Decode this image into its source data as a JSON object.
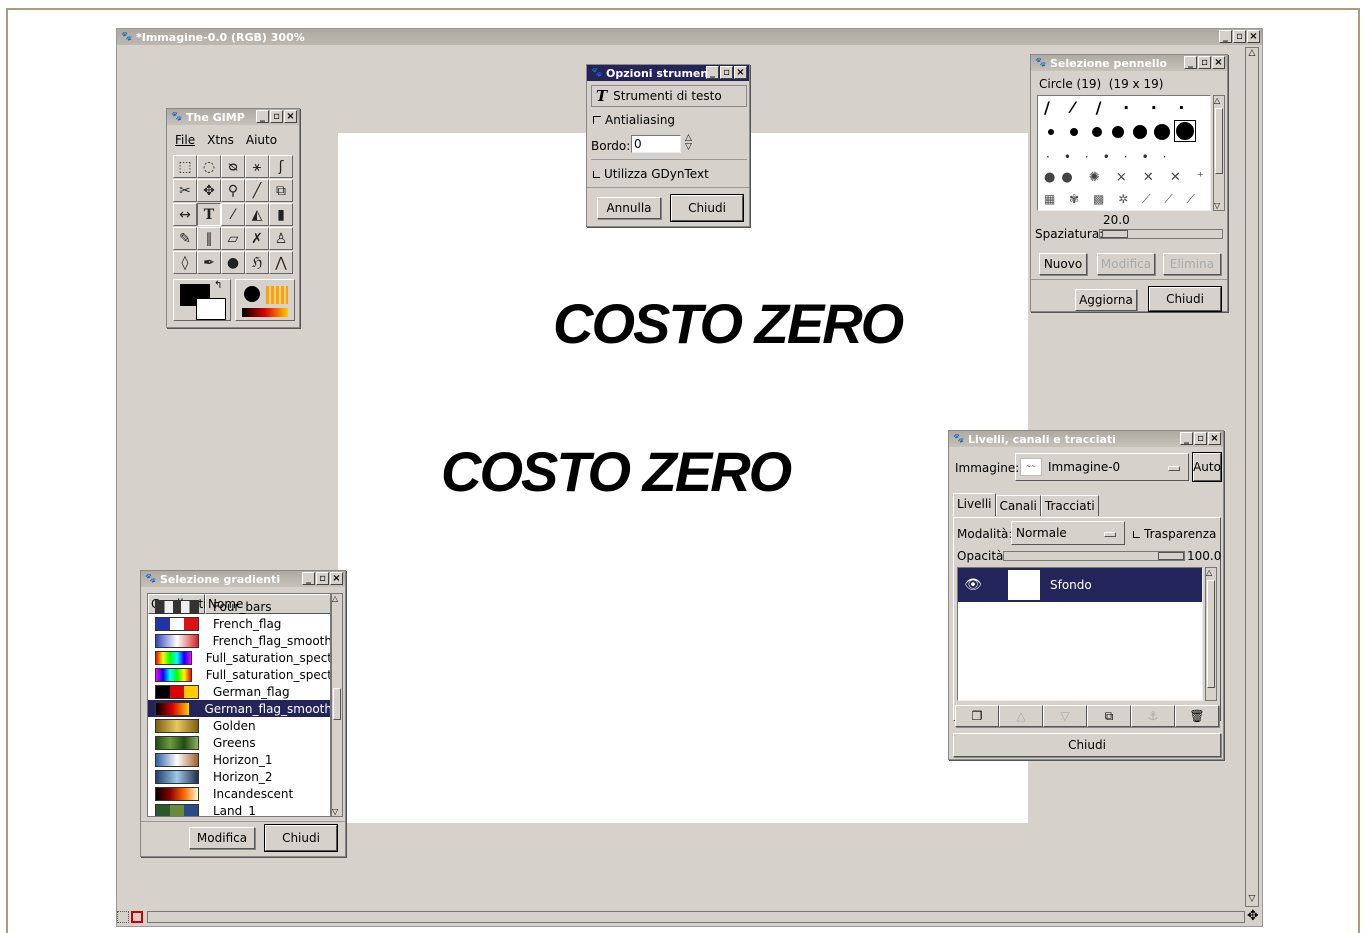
{
  "main_window": {
    "title": "*Immagine-0.0 (RGB) 300%",
    "canvas_text_1": "COSTO ZERO",
    "canvas_text_2": "COSTO ZERO"
  },
  "toolbox": {
    "title": "The GIMP",
    "menu": [
      "File",
      "Xtns",
      "Aiuto"
    ]
  },
  "tool_options": {
    "title": "Opzioni strumenti",
    "tool_label": "Strumenti di testo",
    "antialiasing_label": "Antialiasing",
    "border_label": "Bordo:",
    "border_value": "0",
    "gdyntext_label": "Utilizza GDynText",
    "cancel_label": "Annulla",
    "close_label": "Chiudi"
  },
  "brush_selector": {
    "title": "Selezione pennello",
    "brush_name": "Circle (19)  (19 x 19)",
    "spacing_value": "20.0",
    "spacing_label": "Spaziatura:",
    "new_label": "Nuovo",
    "edit_label": "Modifica",
    "delete_label": "Elimina",
    "refresh_label": "Aggiorna",
    "close_label": "Chiudi"
  },
  "layers_dialog": {
    "title": "Livelli, canali e tracciati",
    "image_label": "Immagine:",
    "image_value": "Immagine-0",
    "auto_label": "Auto",
    "tabs": [
      "Livelli",
      "Canali",
      "Tracciati"
    ],
    "mode_label": "Modalità:",
    "mode_value": "Normale",
    "transparency_label": "Trasparenza",
    "opacity_label": "Opacità",
    "opacity_value": "100.0",
    "layer_name": "Sfondo",
    "close_label": "Chiudi"
  },
  "gradient_selector": {
    "title": "Selezione gradienti",
    "col_gradient": "Gradienti",
    "col_name": "Nome",
    "modify_label": "Modifica",
    "close_label": "Chiudi",
    "items": [
      {
        "name": "Four_bars",
        "colors": [
          "#333",
          "#eee",
          "#333",
          "#eee",
          "#333"
        ],
        "partial": true
      },
      {
        "name": "French_flag",
        "colors": [
          "#2233aa",
          "#ffffff",
          "#dd1111"
        ]
      },
      {
        "name": "French_flag_smooth",
        "colors": [
          "#3344bb",
          "#ffffff",
          "#dd2222"
        ],
        "smooth": true
      },
      {
        "name": "Full_saturation_spect",
        "colors": [
          "#ff0000",
          "#ffff00",
          "#00ff00",
          "#00ffff",
          "#0000ff",
          "#ff00ff"
        ],
        "smooth": true
      },
      {
        "name": "Full_saturation_spect",
        "colors": [
          "#ff00ff",
          "#0000ff",
          "#00ffff",
          "#00ff00",
          "#ffff00",
          "#ff0000"
        ],
        "smooth": true
      },
      {
        "name": "German_flag",
        "colors": [
          "#000000",
          "#dd0000",
          "#ffcc00"
        ]
      },
      {
        "name": "German_flag_smooth",
        "colors": [
          "#000000",
          "#dd0000",
          "#ffcc00"
        ],
        "smooth": true,
        "selected": true
      },
      {
        "name": "Golden",
        "colors": [
          "#806010",
          "#e8c860",
          "#806010"
        ],
        "smooth": true
      },
      {
        "name": "Greens",
        "colors": [
          "#1f4d12",
          "#6b9c3c",
          "#1f4d12",
          "#8fb05c"
        ],
        "smooth": true
      },
      {
        "name": "Horizon_1",
        "colors": [
          "#3060a0",
          "#ffffff",
          "#a06030"
        ],
        "smooth": true
      },
      {
        "name": "Horizon_2",
        "colors": [
          "#204070",
          "#a0c8e8",
          "#203050"
        ],
        "smooth": true
      },
      {
        "name": "Incandescent",
        "colors": [
          "#000000",
          "#880000",
          "#ff6600",
          "#ffffcc"
        ],
        "smooth": true
      },
      {
        "name": "Land_1",
        "colors": [
          "#2a5a2a",
          "#6a8a3a",
          "#2a4a8a"
        ],
        "partial": true
      }
    ]
  }
}
